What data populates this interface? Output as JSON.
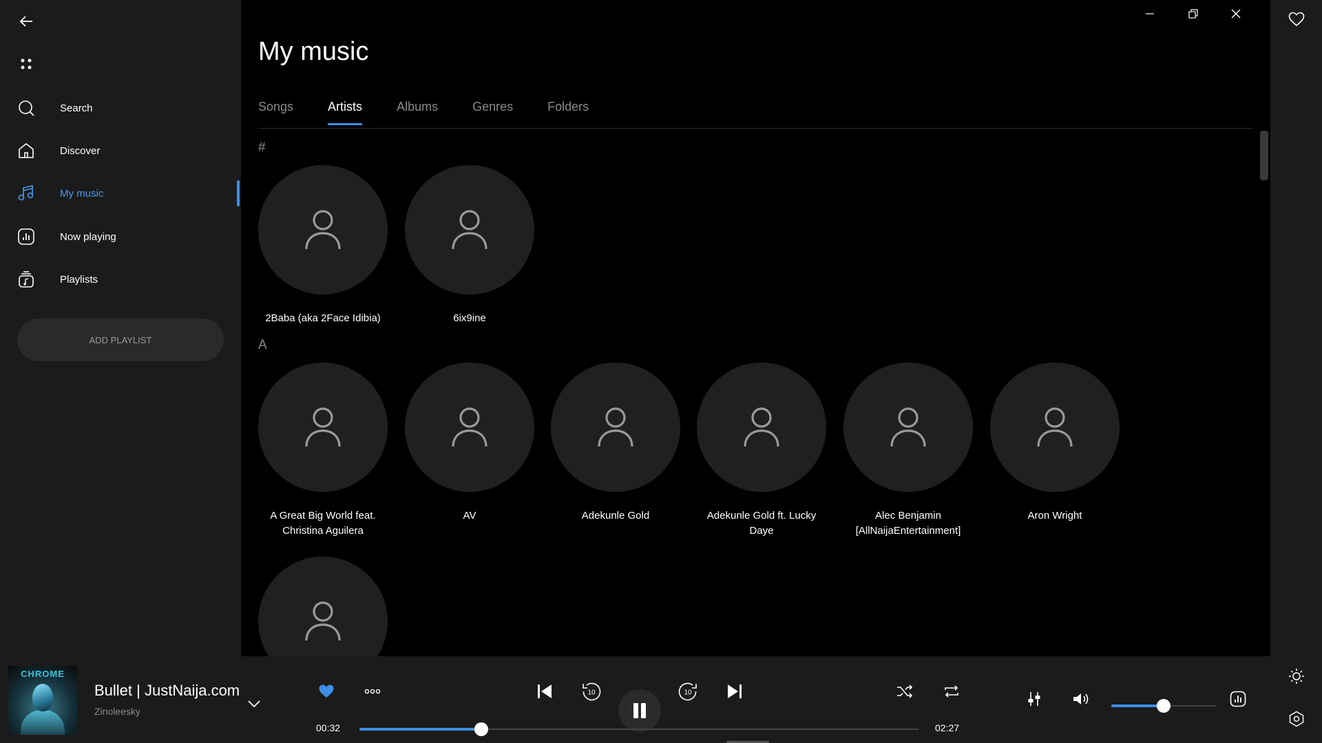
{
  "app": {
    "accent": "#3d8fe6"
  },
  "sidebar": {
    "items": [
      {
        "label": "Search",
        "icon": "search-icon"
      },
      {
        "label": "Discover",
        "icon": "home-icon"
      },
      {
        "label": "My music",
        "icon": "music-note-icon",
        "active": true
      },
      {
        "label": "Now playing",
        "icon": "now-playing-icon"
      },
      {
        "label": "Playlists",
        "icon": "playlists-icon"
      }
    ],
    "add_playlist": "ADD PLAYLIST"
  },
  "main": {
    "title": "My music",
    "tabs": [
      {
        "label": "Songs"
      },
      {
        "label": "Artists",
        "active": true
      },
      {
        "label": "Albums"
      },
      {
        "label": "Genres"
      },
      {
        "label": "Folders"
      }
    ],
    "sections": [
      {
        "letter": "#",
        "artists": [
          "2Baba (aka 2Face Idibia)",
          "6ix9ine"
        ]
      },
      {
        "letter": "A",
        "artists": [
          "A Great Big World feat. Christina Aguilera",
          "AV",
          "Adekunle Gold",
          "Adekunle Gold ft. Lucky Daye",
          "Alec Benjamin [AllNaijaEntertainment]",
          "Aron Wright"
        ]
      }
    ]
  },
  "player": {
    "album_art_text": "CHROME",
    "title": "Bullet | JustNaija.com",
    "artist": "Zinoleesky",
    "current_time": "00:32",
    "total_time": "02:27",
    "progress": 0.218,
    "volume": 0.5,
    "liked": true
  }
}
